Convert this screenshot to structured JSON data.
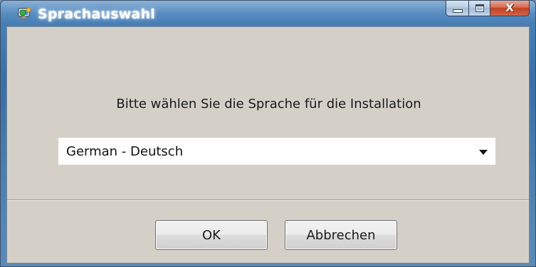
{
  "window": {
    "title": "Sprachauswahl",
    "app_icon": "monitor-globe-icon",
    "caption_buttons": {
      "minimize_icon": "minimize-icon",
      "maximize_icon": "maximize-icon",
      "close_glyph": "X"
    }
  },
  "dialog": {
    "prompt": "Bitte wählen Sie die Sprache für die Installation",
    "language_select": {
      "selected": "German - Deutsch",
      "arrow_icon": "chevron-down-icon"
    }
  },
  "buttons": {
    "ok_label": "OK",
    "cancel_label": "Abbrechen"
  },
  "colors": {
    "titlebar": "#3a6ea6",
    "client_background": "#d4d0c8",
    "close_button": "#c0411f"
  }
}
